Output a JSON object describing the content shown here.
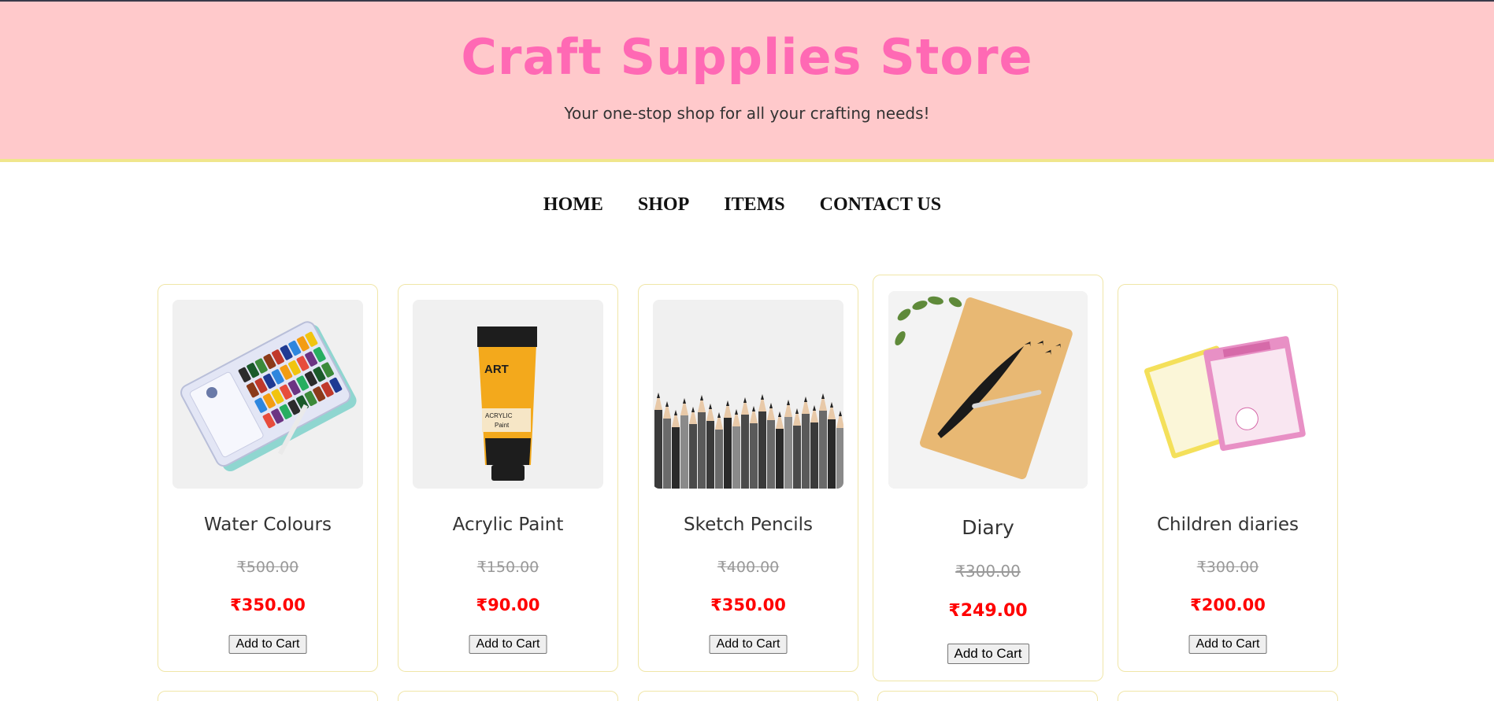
{
  "header": {
    "title": "Craft Supplies Store",
    "tagline": "Your one-stop shop for all your crafting needs!"
  },
  "nav": [
    "HOME",
    "SHOP",
    "ITEMS",
    "CONTACT US"
  ],
  "colors": {
    "header_bg": "#ffc9cb",
    "title": "#ff69b4",
    "header_border": "#f0e68c",
    "sale_price": "#ff0000",
    "old_price": "#999999"
  },
  "products": [
    {
      "name": "Water Colours",
      "old_price": "₹500.00",
      "price": "₹350.00",
      "button": "Add to Cart",
      "image": "watercolor-palette-image"
    },
    {
      "name": "Acrylic Paint",
      "old_price": "₹150.00",
      "price": "₹90.00",
      "button": "Add to Cart",
      "image": "acrylic-paint-tube-image"
    },
    {
      "name": "Sketch Pencils",
      "old_price": "₹400.00",
      "price": "₹350.00",
      "button": "Add to Cart",
      "image": "sketch-pencils-image"
    },
    {
      "name": "Diary",
      "old_price": "₹300.00",
      "price": "₹249.00",
      "button": "Add to Cart",
      "image": "wooden-diary-image"
    },
    {
      "name": "Children diaries",
      "old_price": "₹300.00",
      "price": "₹200.00",
      "button": "Add to Cart",
      "image": "children-diaries-image"
    }
  ],
  "tube_text": {
    "brand": "ART",
    "line1": "ACRYLIC",
    "line2": "Paint"
  }
}
